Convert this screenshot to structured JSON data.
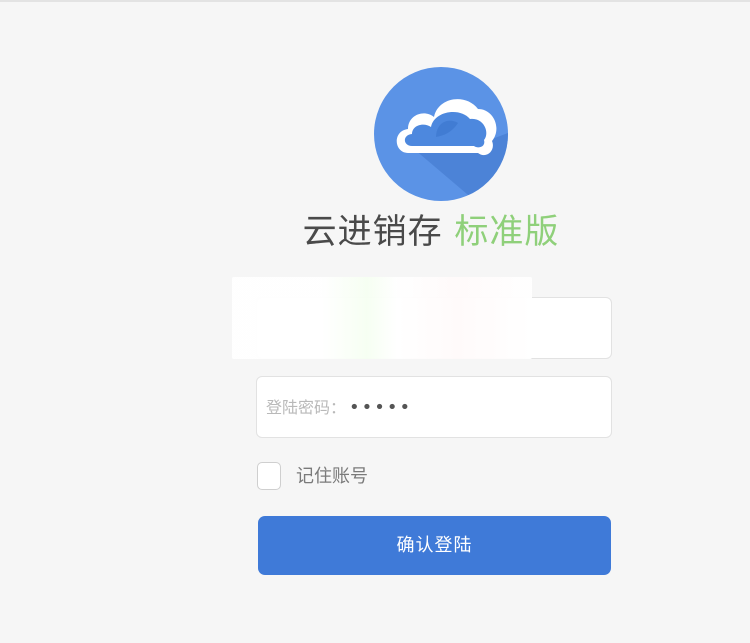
{
  "app": {
    "title": "云进销存",
    "edition": "标准版"
  },
  "login": {
    "username_value": "",
    "password_label": "登陆密码：",
    "password_value": "•••••",
    "remember_label": "记住账号",
    "remember_checked": false,
    "submit_label": "确认登陆"
  },
  "colors": {
    "accent": "#3f7ad8",
    "logo": "#5b93e6",
    "edition": "#8fd07a"
  },
  "icons": {
    "logo": "cloud-icon"
  }
}
